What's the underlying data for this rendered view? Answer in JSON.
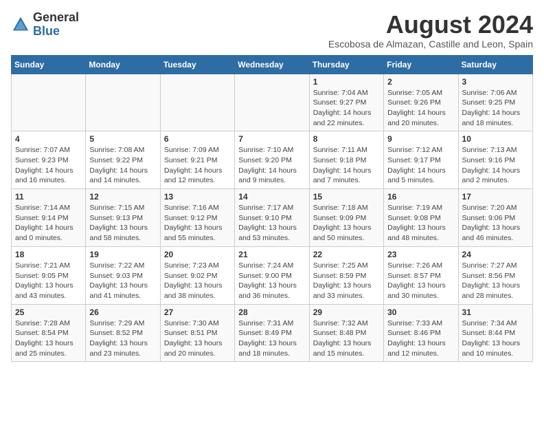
{
  "header": {
    "logo_general": "General",
    "logo_blue": "Blue",
    "month_year": "August 2024",
    "location": "Escobosa de Almazan, Castille and Leon, Spain"
  },
  "calendar": {
    "days_of_week": [
      "Sunday",
      "Monday",
      "Tuesday",
      "Wednesday",
      "Thursday",
      "Friday",
      "Saturday"
    ],
    "weeks": [
      [
        {
          "day": "",
          "info": ""
        },
        {
          "day": "",
          "info": ""
        },
        {
          "day": "",
          "info": ""
        },
        {
          "day": "",
          "info": ""
        },
        {
          "day": "1",
          "info": "Sunrise: 7:04 AM\nSunset: 9:27 PM\nDaylight: 14 hours and 22 minutes."
        },
        {
          "day": "2",
          "info": "Sunrise: 7:05 AM\nSunset: 9:26 PM\nDaylight: 14 hours and 20 minutes."
        },
        {
          "day": "3",
          "info": "Sunrise: 7:06 AM\nSunset: 9:25 PM\nDaylight: 14 hours and 18 minutes."
        }
      ],
      [
        {
          "day": "4",
          "info": "Sunrise: 7:07 AM\nSunset: 9:23 PM\nDaylight: 14 hours and 16 minutes."
        },
        {
          "day": "5",
          "info": "Sunrise: 7:08 AM\nSunset: 9:22 PM\nDaylight: 14 hours and 14 minutes."
        },
        {
          "day": "6",
          "info": "Sunrise: 7:09 AM\nSunset: 9:21 PM\nDaylight: 14 hours and 12 minutes."
        },
        {
          "day": "7",
          "info": "Sunrise: 7:10 AM\nSunset: 9:20 PM\nDaylight: 14 hours and 9 minutes."
        },
        {
          "day": "8",
          "info": "Sunrise: 7:11 AM\nSunset: 9:18 PM\nDaylight: 14 hours and 7 minutes."
        },
        {
          "day": "9",
          "info": "Sunrise: 7:12 AM\nSunset: 9:17 PM\nDaylight: 14 hours and 5 minutes."
        },
        {
          "day": "10",
          "info": "Sunrise: 7:13 AM\nSunset: 9:16 PM\nDaylight: 14 hours and 2 minutes."
        }
      ],
      [
        {
          "day": "11",
          "info": "Sunrise: 7:14 AM\nSunset: 9:14 PM\nDaylight: 14 hours and 0 minutes."
        },
        {
          "day": "12",
          "info": "Sunrise: 7:15 AM\nSunset: 9:13 PM\nDaylight: 13 hours and 58 minutes."
        },
        {
          "day": "13",
          "info": "Sunrise: 7:16 AM\nSunset: 9:12 PM\nDaylight: 13 hours and 55 minutes."
        },
        {
          "day": "14",
          "info": "Sunrise: 7:17 AM\nSunset: 9:10 PM\nDaylight: 13 hours and 53 minutes."
        },
        {
          "day": "15",
          "info": "Sunrise: 7:18 AM\nSunset: 9:09 PM\nDaylight: 13 hours and 50 minutes."
        },
        {
          "day": "16",
          "info": "Sunrise: 7:19 AM\nSunset: 9:08 PM\nDaylight: 13 hours and 48 minutes."
        },
        {
          "day": "17",
          "info": "Sunrise: 7:20 AM\nSunset: 9:06 PM\nDaylight: 13 hours and 46 minutes."
        }
      ],
      [
        {
          "day": "18",
          "info": "Sunrise: 7:21 AM\nSunset: 9:05 PM\nDaylight: 13 hours and 43 minutes."
        },
        {
          "day": "19",
          "info": "Sunrise: 7:22 AM\nSunset: 9:03 PM\nDaylight: 13 hours and 41 minutes."
        },
        {
          "day": "20",
          "info": "Sunrise: 7:23 AM\nSunset: 9:02 PM\nDaylight: 13 hours and 38 minutes."
        },
        {
          "day": "21",
          "info": "Sunrise: 7:24 AM\nSunset: 9:00 PM\nDaylight: 13 hours and 36 minutes."
        },
        {
          "day": "22",
          "info": "Sunrise: 7:25 AM\nSunset: 8:59 PM\nDaylight: 13 hours and 33 minutes."
        },
        {
          "day": "23",
          "info": "Sunrise: 7:26 AM\nSunset: 8:57 PM\nDaylight: 13 hours and 30 minutes."
        },
        {
          "day": "24",
          "info": "Sunrise: 7:27 AM\nSunset: 8:56 PM\nDaylight: 13 hours and 28 minutes."
        }
      ],
      [
        {
          "day": "25",
          "info": "Sunrise: 7:28 AM\nSunset: 8:54 PM\nDaylight: 13 hours and 25 minutes."
        },
        {
          "day": "26",
          "info": "Sunrise: 7:29 AM\nSunset: 8:52 PM\nDaylight: 13 hours and 23 minutes."
        },
        {
          "day": "27",
          "info": "Sunrise: 7:30 AM\nSunset: 8:51 PM\nDaylight: 13 hours and 20 minutes."
        },
        {
          "day": "28",
          "info": "Sunrise: 7:31 AM\nSunset: 8:49 PM\nDaylight: 13 hours and 18 minutes."
        },
        {
          "day": "29",
          "info": "Sunrise: 7:32 AM\nSunset: 8:48 PM\nDaylight: 13 hours and 15 minutes."
        },
        {
          "day": "30",
          "info": "Sunrise: 7:33 AM\nSunset: 8:46 PM\nDaylight: 13 hours and 12 minutes."
        },
        {
          "day": "31",
          "info": "Sunrise: 7:34 AM\nSunset: 8:44 PM\nDaylight: 13 hours and 10 minutes."
        }
      ]
    ]
  }
}
